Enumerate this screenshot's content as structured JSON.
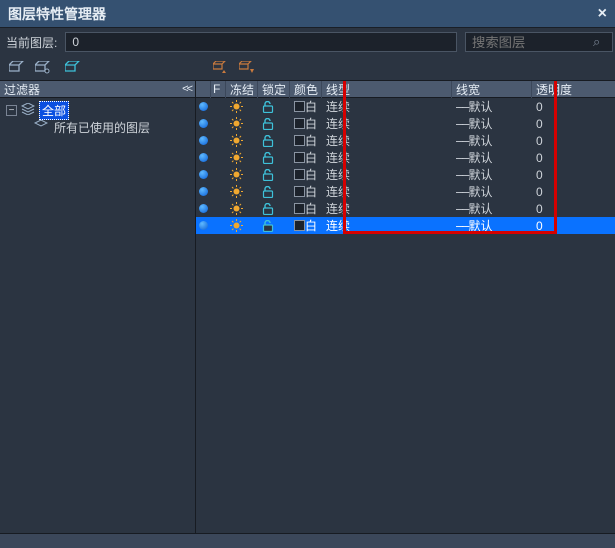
{
  "title": "图层特性管理器",
  "current_layer_label": "当前图层:",
  "current_layer_value": "0",
  "search_placeholder": "搜索图层",
  "filter_head": "过滤器",
  "tree": {
    "all_label": "全部",
    "used_label": "所有已使用的图层"
  },
  "columns": {
    "status": "",
    "f": "F",
    "freeze": "冻结",
    "lock": "锁定",
    "color": "颜色",
    "linetype": "线型",
    "lineweight": "线宽",
    "transparency": "透明度"
  },
  "row_defaults": {
    "color_name": "白",
    "linetype": "连续",
    "lineweight": "默认",
    "transparency": "0"
  },
  "rows": [
    {
      "selected": false
    },
    {
      "selected": false
    },
    {
      "selected": false
    },
    {
      "selected": false
    },
    {
      "selected": false
    },
    {
      "selected": false
    },
    {
      "selected": false
    },
    {
      "selected": true
    }
  ]
}
